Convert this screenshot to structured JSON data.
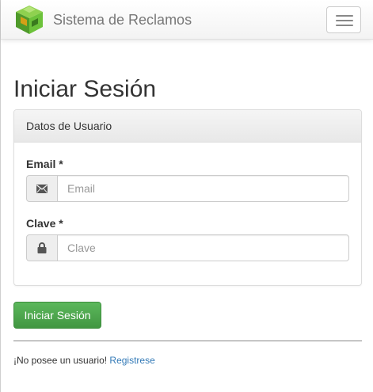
{
  "navbar": {
    "brand": "Sistema de Reclamos",
    "logo_icon": "green-cube-logo-icon",
    "menu_icon": "hamburger-menu-icon"
  },
  "page": {
    "title": "Iniciar Sesión"
  },
  "panel": {
    "heading": "Datos de Usuario",
    "email": {
      "label": "Email *",
      "placeholder": "Email",
      "value": "",
      "icon": "envelope-icon"
    },
    "password": {
      "label": "Clave *",
      "placeholder": "Clave",
      "value": "",
      "icon": "lock-icon"
    }
  },
  "actions": {
    "login_button": "Iniciar Sesión"
  },
  "footer": {
    "question": "¡No posee un usuario!",
    "register_link": "Registrese"
  },
  "colors": {
    "primary_button": "#5cb85c",
    "link": "#337ab7",
    "brand_text": "#777777"
  }
}
